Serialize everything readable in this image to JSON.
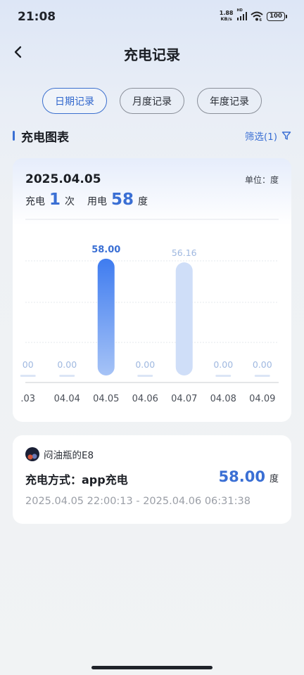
{
  "status_bar": {
    "time": "21:08",
    "net_speed_value": "1.88",
    "net_speed_unit": "KB/s",
    "signal_tag": "HD",
    "battery": "100",
    "icons": [
      "signal-icon",
      "wifi-icon",
      "battery-icon"
    ]
  },
  "header": {
    "title": "充电记录",
    "back_icon": "chevron-left-icon"
  },
  "tabs": [
    {
      "label": "日期记录",
      "active": true
    },
    {
      "label": "月度记录",
      "active": false
    },
    {
      "label": "年度记录",
      "active": false
    }
  ],
  "section": {
    "title": "充电图表",
    "filter_label": "筛选(1)",
    "filter_icon": "funnel-icon"
  },
  "chart_card": {
    "date": "2025.04.05",
    "unit_label": "单位：度",
    "charge_label": "充电",
    "charge_count": "1",
    "charge_count_unit": "次",
    "energy_label": "用电",
    "energy_value": "58",
    "energy_unit": "度"
  },
  "chart_data": {
    "type": "bar",
    "categories": [
      ".03",
      "04.04",
      "04.05",
      "04.06",
      "04.07",
      "04.08",
      "04.09"
    ],
    "values": [
      0,
      0,
      58,
      0,
      56.16,
      0,
      0
    ],
    "value_labels": [
      "00",
      "0.00",
      "58.00",
      "0.00",
      "56.16",
      "0.00",
      "0.00"
    ],
    "selected_index": 2,
    "ylim": [
      0,
      60
    ],
    "grid": true,
    "colors": {
      "selected_top": "#3f7cf0",
      "selected_bottom": "#a6c3f6",
      "normal": "#cfdef8",
      "zero_label": "#9fb8e0",
      "selected_label": "#3a6fd4"
    }
  },
  "record": {
    "vehicle_name": "闷油瓶的E8",
    "method": "充电方式：app充电",
    "amount": "58.00",
    "amount_unit": "度",
    "time_range": "2025.04.05 22:00:13 - 2025.04.06 06:31:38"
  }
}
